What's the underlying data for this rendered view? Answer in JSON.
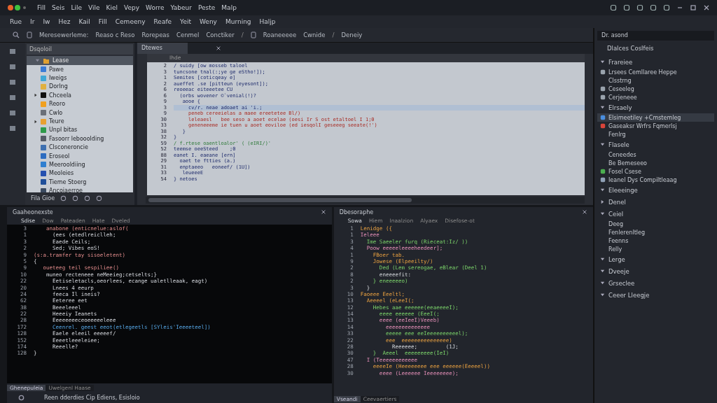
{
  "menu_bar": [
    "Fill",
    "Seis",
    "Lile",
    "Vile",
    "Kiel",
    "Vepy",
    "Worre",
    "Yabeur",
    "Peste",
    "Malp"
  ],
  "menu_bar_second": [
    "Rue",
    "Ir",
    "Iw",
    "Hez",
    "Kail",
    "Fill",
    "Cemeeny",
    "Reafe",
    "Yeit",
    "Weny",
    "Murning",
    "Haljp"
  ],
  "breadcrumbs": [
    {
      "kind": "crumb",
      "label": "Meresewerleme:"
    },
    {
      "kind": "crumb",
      "label": "Reaso c Reso"
    },
    {
      "kind": "crumb",
      "label": "Rorepeas"
    },
    {
      "kind": "crumb",
      "label": "Cenmel"
    },
    {
      "kind": "crumb",
      "label": "Conctiker"
    },
    {
      "kind": "separator",
      "label": "/"
    },
    {
      "kind": "crumb",
      "label": "Roaneeeee"
    },
    {
      "kind": "crumb",
      "label": "Cwnide"
    },
    {
      "kind": "separator",
      "label": "/"
    },
    {
      "kind": "crumb",
      "label": "Deneiy"
    }
  ],
  "file_tree": {
    "search": {
      "value": "Dsqoloil"
    },
    "root": {
      "label": "Lease",
      "expanded": true,
      "selected": true
    },
    "items": [
      {
        "label": "Pawe",
        "color": "#3a7bd5",
        "expandable": false
      },
      {
        "label": "Iweigs",
        "color": "#3fa7d6",
        "expandable": false
      },
      {
        "label": "Dorlng",
        "color": "#e0b040",
        "expandable": false
      },
      {
        "label": "Chceela",
        "color": "#111111",
        "expandable": true
      },
      {
        "label": "Reoro",
        "color": "#f0a020",
        "expandable": false
      },
      {
        "label": "Cwlo",
        "color": "#6a6f78",
        "expandable": false
      },
      {
        "label": "Teure",
        "color": "#e8a030",
        "expandable": true
      },
      {
        "label": "Unpl bitas",
        "color": "#2e9a4a",
        "expandable": false
      },
      {
        "label": "Fasoorr lebooolding",
        "color": "#555b66",
        "expandable": false
      },
      {
        "label": "Clsconeroncie",
        "color": "#3d6fb0",
        "expandable": false
      },
      {
        "label": "Eroseol",
        "color": "#2d6cc0",
        "expandable": false
      },
      {
        "label": "Meerooldiing",
        "color": "#2f7fd0",
        "expandable": false
      },
      {
        "label": "Meoleies",
        "color": "#2450b0",
        "expandable": false
      },
      {
        "label": "Tieme Stoerg",
        "color": "#1f4f9a",
        "expandable": false
      },
      {
        "label": "Ancoiaerroe",
        "color": "#3a4a60",
        "expandable": false
      }
    ],
    "footer": "Fila  Gioe"
  },
  "editor": {
    "tab": "Dtewes",
    "subheader": "Ihde",
    "lines": [
      {
        "number": "2",
        "text": "/ suidy [ow mosseb taloel",
        "kind": "plain",
        "selected": false
      },
      {
        "number": "3",
        "text": "tuncsone tnal(:;ye ge eStho!]);",
        "kind": "plain",
        "selected": false
      },
      {
        "number": "1",
        "text": "Semites [coticqeay e]",
        "kind": "plain",
        "selected": false
      },
      {
        "number": "2",
        "text": "aueffet .se [pitteun (eyesont]);",
        "kind": "plain",
        "selected": false
      },
      {
        "number": "6",
        "text": "reoeeac eiteeetee CU",
        "kind": "plain",
        "selected": false
      },
      {
        "number": "6",
        "text": "  (orbs wovener ©`venial(!)?",
        "kind": "plain",
        "selected": false
      },
      {
        "number": "9",
        "text": "   aooe {",
        "kind": "plain",
        "selected": false
      },
      {
        "number": "3",
        "text": "     cv/r. neae adoaet ai 'i.;",
        "kind": "plain",
        "selected": true
      },
      {
        "number": "9",
        "text": "     peneb cereeielas a maee ereetetee Bl/)",
        "kind": "error",
        "selected": false
      },
      {
        "number": "30",
        "text": "     leleaesl   bee seso a aoet ecelae (oesi Ir S ost etaltoel I 1;0",
        "kind": "error",
        "selected": false
      },
      {
        "number": "33",
        "text": "     geneneeeme ie tuen u aoet eoviloe (ed iesqolI geseeeg seeate(!')",
        "kind": "error",
        "selected": false
      },
      {
        "number": "38",
        "text": "   }",
        "kind": "plain",
        "selected": false
      },
      {
        "number": "32",
        "text": "}",
        "kind": "plain",
        "selected": false
      },
      {
        "number": "59",
        "text": "/ f.rtese oaentloalor' ( (eIRI/)'",
        "kind": "comment",
        "selected": false
      },
      {
        "number": "52",
        "text": "teemse oeeSteed    ;0",
        "kind": "plain",
        "selected": false
      },
      {
        "number": "88",
        "text": "eanet I. eaeane [ern]",
        "kind": "plain",
        "selected": false
      },
      {
        "number": "29",
        "text": "  oaet te ftties (a.)",
        "kind": "plain",
        "selected": false
      },
      {
        "number": "31",
        "text": "  enptaeeo   eoneef/ (1U])",
        "kind": "plain",
        "selected": false
      },
      {
        "number": "33",
        "text": "   leueeeE",
        "kind": "plain",
        "selected": false
      },
      {
        "number": "54",
        "text": "} netoes",
        "kind": "plain",
        "selected": false
      }
    ]
  },
  "output_panel": {
    "title": "Gaaheonexste",
    "tabs": [
      {
        "label": "Sdise",
        "selected": true
      },
      {
        "label": "Dow",
        "selected": false
      },
      {
        "label": "Pateaden",
        "selected": false
      },
      {
        "label": "Hate",
        "selected": false
      },
      {
        "label": "Dveled",
        "selected": false
      }
    ],
    "lines": [
      {
        "number": "3",
        "text": "    anabone (enticnelue:aslof(",
        "kind": "keyword"
      },
      {
        "number": "1",
        "text": "      (ees (etedlreiclleh;",
        "kind": "plain"
      },
      {
        "number": "3",
        "text": "      Eaede Ceils;",
        "kind": "plain"
      },
      {
        "number": "2",
        "text": "      Sed; Vibes eoS!",
        "kind": "plain"
      },
      {
        "number": "9",
        "text": "(s:a.tramfer tay sisoeletent)",
        "kind": "keyword"
      },
      {
        "number": "5",
        "text": "{",
        "kind": "plain"
      },
      {
        "number": "9",
        "text": "   oueteeg teil sespiliee()",
        "kind": "keyword"
      },
      {
        "number": "10",
        "text": "    muneo recteneee neMeeieg;cetselts;}",
        "kind": "plain"
      },
      {
        "number": "22",
        "text": "      Eetiseletacls,oeorlees, ecange ualetlleaak, eagt)",
        "kind": "plain"
      },
      {
        "number": "20",
        "text": "      Lnees 4 eeurp",
        "kind": "plain"
      },
      {
        "number": "24",
        "text": "      feeca Il ineis?",
        "kind": "plain"
      },
      {
        "number": "62",
        "text": "      Eeteree eet",
        "kind": "plain"
      },
      {
        "number": "38",
        "text": "      Beeeleeel",
        "kind": "plain"
      },
      {
        "number": "22",
        "text": "      Heeeiy Ieanets",
        "kind": "plain"
      },
      {
        "number": "28",
        "text": "      Eeeeeeeeceoeeeeeleee",
        "kind": "plain"
      },
      {
        "number": "172",
        "text": "      Ceenrel. geest eeot(etlegeetls [SYleis'Ieeeeteel])",
        "kind": "string"
      },
      {
        "number": "128",
        "text": "      Eaele eleeil eeeeef/",
        "kind": "plain"
      },
      {
        "number": "152",
        "text": "      Eeeetleeeleiee;",
        "kind": "plain"
      },
      {
        "number": "174",
        "text": "      Reeelle?",
        "kind": "plain"
      },
      {
        "number": "128",
        "text": "}",
        "kind": "plain"
      }
    ],
    "bottom_tabs": [
      {
        "label": "Ghenepuleia",
        "selected": true
      },
      {
        "label": "Uwelgenl Haase",
        "selected": false
      }
    ],
    "status": "Reen dderdies Cip Ediens, Esisloio"
  },
  "debug_panel": {
    "title": "Dbesoraphe",
    "tabs": [
      {
        "label": "Sowa",
        "selected": true
      },
      {
        "label": "Hiem",
        "selected": false
      },
      {
        "label": "Inaalzion",
        "selected": false
      },
      {
        "label": "Alyaex",
        "selected": false
      },
      {
        "label": "Disefose-ot",
        "selected": false
      }
    ],
    "lines": [
      {
        "number": "1",
        "text": "Lenidge ({",
        "kind": "call"
      },
      {
        "number": "1",
        "text": "Ieleee",
        "kind": "keyword"
      },
      {
        "number": "3",
        "text": "  Ime Saeeler furq (Rieceat:Iz/ ))",
        "kind": "string"
      },
      {
        "number": "4",
        "text": "  Poow eeeeeleeeeheedeer];",
        "kind": "keyword"
      },
      {
        "number": "1",
        "text": "    FBoer tab.",
        "kind": "call"
      },
      {
        "number": "9",
        "text": "    Jowese (Elpeeilty/)",
        "kind": "call"
      },
      {
        "number": "2",
        "text": "      Ded (Lem sereogae, eBlear (Deel 1)",
        "kind": "string"
      },
      {
        "number": "8",
        "text": "      eneeeefit:",
        "kind": "plain"
      },
      {
        "number": "2",
        "text": "    } eneeeeeo)",
        "kind": "string"
      },
      {
        "number": "3",
        "text": "  }",
        "kind": "plain"
      },
      {
        "number": "10",
        "text": "Faoeee Eeeltl;",
        "kind": "call"
      },
      {
        "number": "13",
        "text": "  Aeeeel (eLeeI(;",
        "kind": "call"
      },
      {
        "number": "12",
        "text": "    Hebes aae eeeeee(eeaeeeeI);",
        "kind": "string"
      },
      {
        "number": "14",
        "text": "      eeee eeeeee (EeeI(;",
        "kind": "string"
      },
      {
        "number": "13",
        "text": "      eeee (eeIeeI)Veeeb)",
        "kind": "keyword"
      },
      {
        "number": "14",
        "text": "        eeeeeeeeeeeeee",
        "kind": "keyword"
      },
      {
        "number": "33",
        "text": "        eeeee eee eeIeeeeeeeeeel);",
        "kind": "string"
      },
      {
        "number": "22",
        "text": "        eee  eeeeeeeeeeeeeee)",
        "kind": "call"
      },
      {
        "number": "28",
        "text": "          Reeeeee;         (1J;",
        "kind": "plain"
      },
      {
        "number": "30",
        "text": "    }  Aeeel  eeeeeeeee(IeI)",
        "kind": "string"
      },
      {
        "number": "47",
        "text": "  I (Teeeeeeeeeeee",
        "kind": "keyword"
      },
      {
        "number": "28",
        "text": "    eeeeIe (Heeeeeeee eee eeeeee(Eeeeel))",
        "kind": "call"
      },
      {
        "number": "30",
        "text": "      eeee (Leeeeee Ieeeeeeee);",
        "kind": "keyword"
      }
    ],
    "bottom_tabs": [
      {
        "label": "Vseandi",
        "selected": true
      },
      {
        "label": "Ceevaertiers",
        "selected": false
      }
    ]
  },
  "outline_panel": {
    "search": {
      "value": "Dr. asond"
    },
    "header": "Dlalces Coslfeis",
    "sections": [
      {
        "label": "Frareiee",
        "expanded": true,
        "children": [
          {
            "label": "Lrsees Cemllaree Heppe",
            "selected": false,
            "color": "#9aa3ad"
          },
          {
            "label": "Clsstrng",
            "selected": false
          },
          {
            "label": "Ceseeleg",
            "selected": false,
            "color": "#9aa3ad"
          },
          {
            "label": "Cerjeneee",
            "selected": false,
            "color": "#9aa3ad"
          }
        ]
      },
      {
        "label": "Elrsaely",
        "expanded": true,
        "children": [
          {
            "label": "Elsimeetiley +Cmstemleg",
            "selected": true,
            "color": "#4a8ee0"
          },
          {
            "label": "Gaseaksr Wrfrs Fqmerlsj",
            "selected": false,
            "color": "#d9443a"
          },
          {
            "label": "Fenlrg",
            "selected": false
          }
        ]
      },
      {
        "label": "Flasele",
        "expanded": true,
        "children": [
          {
            "label": "Ceneedes",
            "selected": false
          },
          {
            "label": "Be Bemeseeo",
            "selected": false
          },
          {
            "label": "Fosel Csese",
            "selected": false,
            "color": "#4caf50"
          },
          {
            "label": "Ieanel Dys Compiltleaag",
            "selected": false,
            "color": "#8fa0b5"
          }
        ]
      },
      {
        "label": "Eleeeinge",
        "expanded": true
      },
      {
        "label": "Denel",
        "expanded": false
      },
      {
        "label": "Ceiel",
        "expanded": true,
        "children": [
          {
            "label": "Deeg",
            "selected": false
          },
          {
            "label": "Fenlerenltleg",
            "selected": false
          },
          {
            "label": "Feenns",
            "selected": false
          },
          {
            "label": "Relly",
            "selected": false
          }
        ]
      },
      {
        "label": "Lerge",
        "expanded": true
      },
      {
        "label": "Dveeje",
        "expanded": true
      },
      {
        "label": "Grseclee",
        "expanded": true
      },
      {
        "label": "Ceeer Lleegje",
        "expanded": true
      }
    ]
  }
}
